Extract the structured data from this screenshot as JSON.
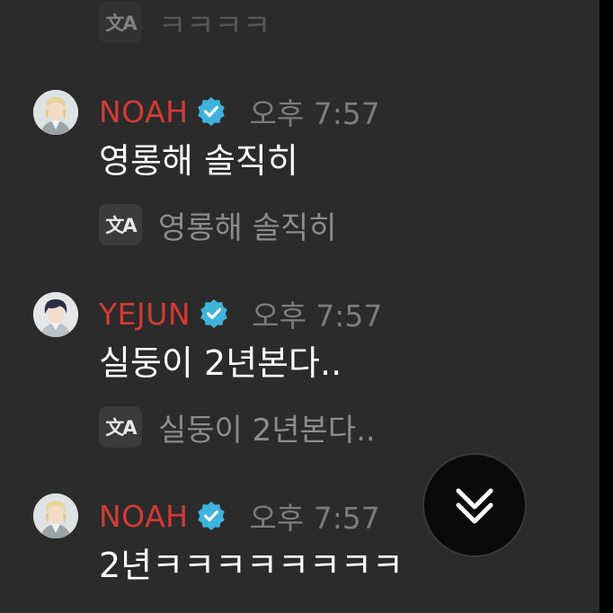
{
  "messages": [
    {
      "translation": {
        "icon": "translate-icon",
        "icon_text": "文A",
        "text": "ㅋㅋㅋㅋ"
      }
    },
    {
      "author": "NOAH",
      "author_color": "#d43a34",
      "verified": true,
      "time": "오후 7:57",
      "text": "영롱해 솔직히",
      "translation": {
        "icon": "translate-icon",
        "icon_text": "文A",
        "text": "영롱해 솔직히"
      }
    },
    {
      "author": "YEJUN",
      "author_color": "#d43a34",
      "verified": true,
      "time": "오후 7:57",
      "text": "실둥이 2년본다..",
      "translation": {
        "icon": "translate-icon",
        "icon_text": "文A",
        "text": "실둥이 2년본다.."
      }
    },
    {
      "author": "NOAH",
      "author_color": "#d43a34",
      "verified": true,
      "time": "오후 7:57",
      "text": "2년ㅋㅋㅋㅋㅋㅋㅋㅋ"
    }
  ],
  "scroll_button": {
    "icon": "double-chevron-down-icon"
  },
  "colors": {
    "background": "#2b2b2b",
    "author": "#d43a34",
    "verified_badge": "#3fb3dc",
    "timestamp": "#7c7c7c",
    "translation_text": "#8c8c8c"
  }
}
